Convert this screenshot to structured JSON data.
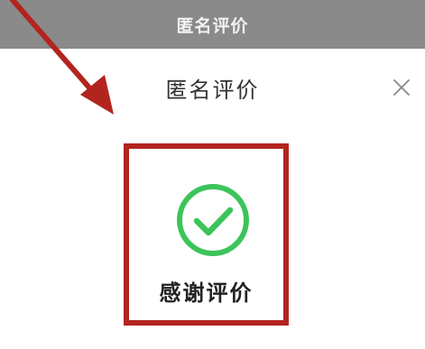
{
  "header": {
    "title": "匿名评价"
  },
  "dialog": {
    "title": "匿名评价",
    "close_icon": "close-icon"
  },
  "result": {
    "icon": "check-circle-icon",
    "message": "感谢评价"
  },
  "colors": {
    "check_green": "#3cc45a",
    "annotation_red": "#b3241f",
    "header_gray": "#8a8a8a"
  }
}
